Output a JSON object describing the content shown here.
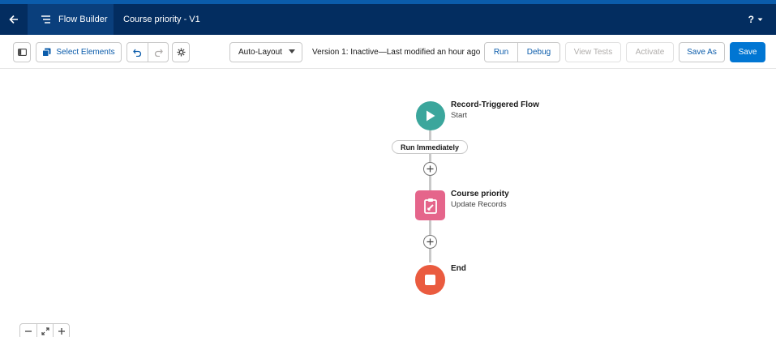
{
  "header": {
    "back_icon": "arrow-left-icon",
    "app_icon": "flow-icon",
    "app_label": "Flow Builder",
    "flow_name": "Course priority - V1",
    "help_label": "?",
    "help_icon": "chevron-down-icon"
  },
  "toolbar": {
    "panel_toggle_icon": "panel-toggle-icon",
    "select_elements_icon": "multi-select-icon",
    "select_elements_label": "Select Elements",
    "undo_icon": "undo-icon",
    "redo_icon": "redo-icon",
    "settings_icon": "gear-icon",
    "layout_value": "Auto-Layout",
    "version_text": "Version 1: Inactive—Last modified an hour ago",
    "run_label": "Run",
    "debug_label": "Debug",
    "view_tests_label": "View Tests",
    "activate_label": "Activate",
    "save_as_label": "Save As",
    "save_label": "Save"
  },
  "canvas": {
    "start": {
      "title": "Record-Triggered Flow",
      "subtitle": "Start",
      "color": "#3ba69c",
      "icon": "play-icon"
    },
    "path_label": "Run Immediately",
    "update": {
      "title": "Course priority",
      "subtitle": "Update Records",
      "color": "#e5658b",
      "icon": "update-records-icon"
    },
    "end": {
      "title": "End",
      "color": "#ea5b3f",
      "icon": "stop-icon"
    },
    "add_icon": "add-element-icon"
  },
  "zoom": {
    "zoom_out_icon": "minus-icon",
    "fit_icon": "fit-view-icon",
    "zoom_in_icon": "plus-icon"
  },
  "colors": {
    "header_bg": "#032d60",
    "brand": "#0176d3",
    "link": "#0b5cab"
  }
}
